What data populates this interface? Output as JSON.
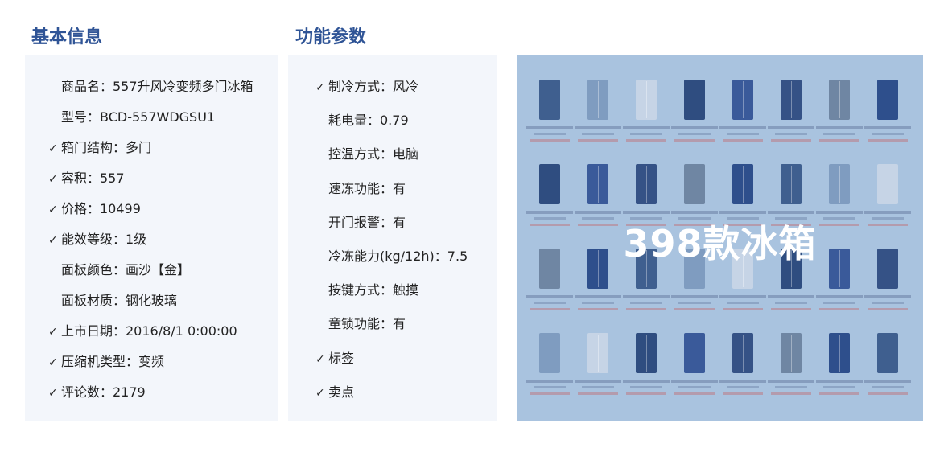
{
  "basic": {
    "title": "基本信息",
    "rows": [
      {
        "checked": false,
        "text": "商品名：557升风冷变频多门冰箱"
      },
      {
        "checked": false,
        "text": "型号：BCD-557WDGSU1"
      },
      {
        "checked": true,
        "text": "箱门结构：多门"
      },
      {
        "checked": true,
        "text": "容积：557"
      },
      {
        "checked": true,
        "text": "价格：10499"
      },
      {
        "checked": true,
        "text": "能效等级：1级"
      },
      {
        "checked": false,
        "text": "面板颜色：画沙【金】"
      },
      {
        "checked": false,
        "text": "面板材质：钢化玻璃"
      },
      {
        "checked": true,
        "text": "上市日期：2016/8/1 0:00:00"
      },
      {
        "checked": true,
        "text": "压缩机类型：变频"
      },
      {
        "checked": true,
        "text": "评论数：2179"
      }
    ]
  },
  "func": {
    "title": "功能参数",
    "rows": [
      {
        "checked": true,
        "text": "制冷方式：风冷"
      },
      {
        "checked": false,
        "text": "耗电量：0.79"
      },
      {
        "checked": false,
        "text": "控温方式：电脑"
      },
      {
        "checked": false,
        "text": "速冻功能：有"
      },
      {
        "checked": false,
        "text": "开门报警：有"
      },
      {
        "checked": false,
        "text": "冷冻能力(kg/12h)：7.5"
      },
      {
        "checked": false,
        "text": "按键方式：触摸"
      },
      {
        "checked": false,
        "text": "童锁功能：有"
      },
      {
        "checked": true,
        "text": "标签"
      },
      {
        "checked": true,
        "text": "卖点"
      }
    ]
  },
  "check_mark": "✓",
  "overlay_text": "398款冰箱",
  "colors": {
    "title": "#2f5496",
    "panel_bg": "#f3f6fb",
    "thumb_bg": "#a9c3df"
  }
}
